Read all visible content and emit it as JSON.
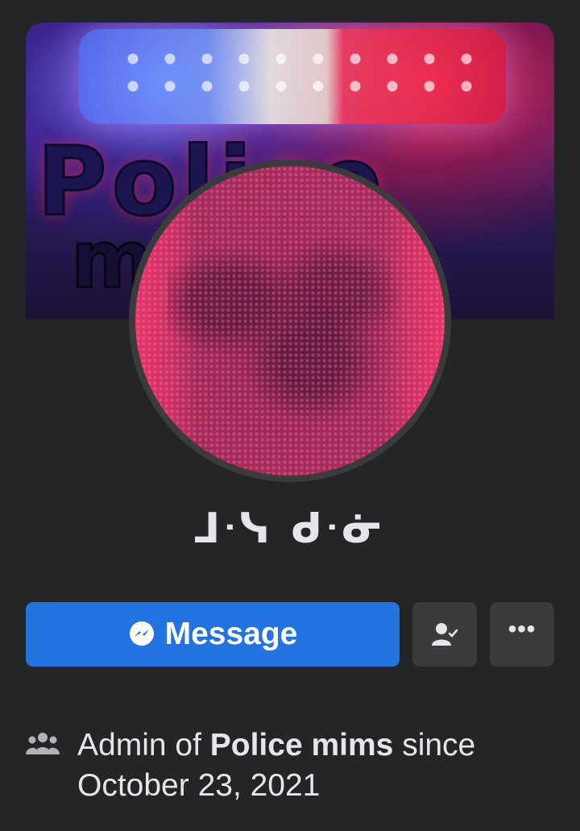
{
  "profile": {
    "name": "ᒧᐧᓭ ᑯᐧᓃ"
  },
  "cover": {
    "line1": "Police",
    "line2": "mims"
  },
  "actions": {
    "message_label": "Message",
    "message_icon": "messenger-icon",
    "friend_icon": "friend-check-icon",
    "more_label": "•••"
  },
  "info": {
    "icon": "group-icon",
    "prefix": "Admin of ",
    "group_name": "Police mims",
    "suffix": " since",
    "date": "October 23, 2021"
  },
  "colors": {
    "background": "#242526",
    "primary_button": "#2374e1",
    "secondary_button": "#3a3b3c",
    "text": "#e4e6eb"
  }
}
